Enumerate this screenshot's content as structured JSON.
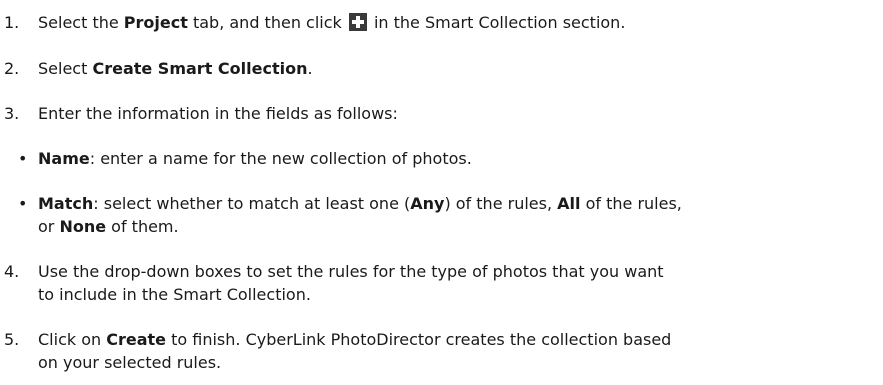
{
  "steps": [
    {
      "number": "1.",
      "parts": [
        "Select the ",
        "Project",
        " tab, and then click ",
        " in the Smart Collection section."
      ]
    },
    {
      "number": "2.",
      "parts": [
        "Select ",
        "Create Smart Collection",
        "."
      ]
    },
    {
      "number": "3.",
      "parts": [
        "Enter the information in the fields as follows:"
      ]
    },
    {
      "number": "4.",
      "line1": "Use the drop-down boxes to set the rules for the type of photos that you want",
      "line2": "to include in the Smart Collection."
    },
    {
      "number": "5.",
      "line1_parts": [
        "Click on ",
        "Create",
        " to finish. CyberLink PhotoDirector creates the collection based"
      ],
      "line2": "on your selected rules."
    }
  ],
  "bullets": [
    {
      "marker": "•",
      "parts": [
        "Name",
        ": enter a name for the new collection of photos."
      ]
    },
    {
      "marker": "•",
      "line1_parts": [
        "Match",
        ": select whether to match at least one (",
        "Any",
        ") of the rules, ",
        "All",
        " of the rules,"
      ],
      "line2_parts": [
        "or ",
        "None",
        " of them."
      ]
    }
  ],
  "icons": {
    "add": "plus-icon"
  }
}
